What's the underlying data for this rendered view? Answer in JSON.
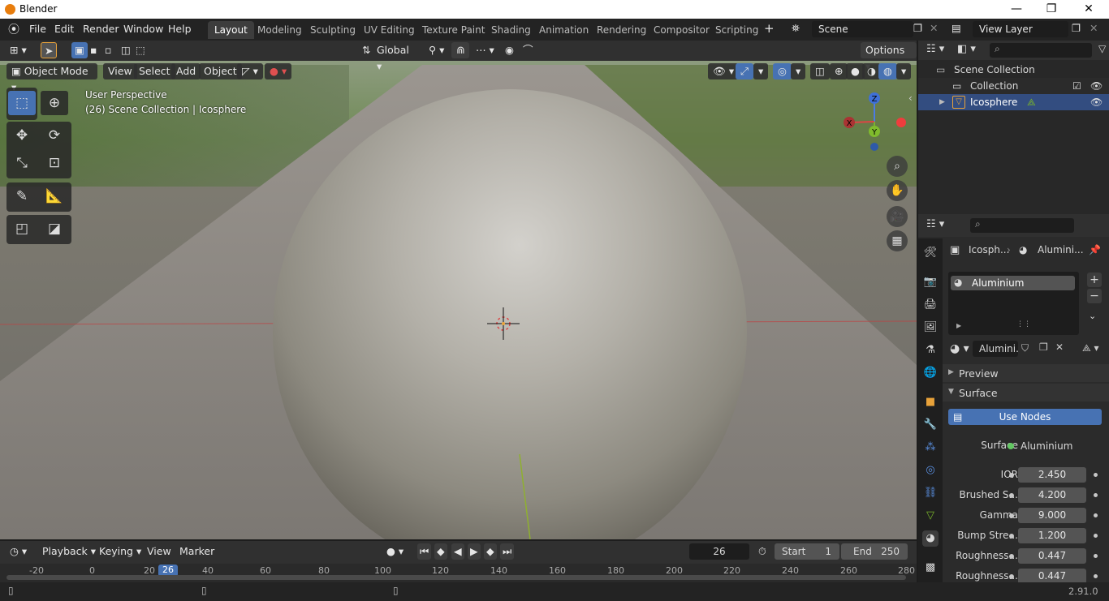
{
  "window": {
    "title": "Blender",
    "controls": {
      "minimize": "—",
      "maximize": "❐",
      "close": "✕"
    }
  },
  "menu": [
    "File",
    "Edit",
    "Render",
    "Window",
    "Help"
  ],
  "workspaces": [
    "Layout",
    "Modeling",
    "Sculpting",
    "UV Editing",
    "Texture Paint",
    "Shading",
    "Animation",
    "Rendering",
    "Compositor",
    "Scripting"
  ],
  "active_workspace": "Layout",
  "scene": {
    "name": "Scene",
    "view_layer": "View Layer"
  },
  "viewport_header": {
    "transform_orientation": "Global",
    "options_label": "Options",
    "mode": "Object Mode",
    "menus": [
      "View",
      "Select",
      "Add",
      "Object"
    ]
  },
  "viewport": {
    "perspective": "User Perspective",
    "info": "(26) Scene Collection | Icosphere",
    "gizmo": {
      "x": "X",
      "y": "Y",
      "z": "Z"
    }
  },
  "outliner": {
    "root": "Scene Collection",
    "collection": "Collection",
    "object": "Icosphere"
  },
  "properties": {
    "breadcrumb_object": "Icosph...",
    "breadcrumb_material": "Alumini...",
    "material_slot": "Aluminium",
    "material_name": "Alumini...",
    "panels": {
      "preview": "Preview",
      "surface": "Surface"
    },
    "use_nodes": "Use Nodes",
    "surface_label": "Surface",
    "surface_value": "Aluminium",
    "fields": [
      {
        "label": "IOR",
        "value": "2.450"
      },
      {
        "label": "Brushed S...",
        "value": "4.200"
      },
      {
        "label": "Gamma",
        "value": "9.000"
      },
      {
        "label": "Bump Stre...",
        "value": "1.200"
      },
      {
        "label": "Roughness...",
        "value": "0.447"
      },
      {
        "label": "Roughness...",
        "value": "0.447"
      }
    ]
  },
  "timeline": {
    "menus": [
      "Playback",
      "Keying",
      "View",
      "Marker"
    ],
    "current_frame": "26",
    "start_label": "Start",
    "start": "1",
    "end_label": "End",
    "end": "250",
    "ruler": [
      "-20",
      "0",
      "20",
      "26",
      "40",
      "60",
      "80",
      "100",
      "120",
      "140",
      "160",
      "180",
      "200",
      "220",
      "240",
      "260",
      "280"
    ]
  },
  "status": {
    "version": "2.91.0"
  },
  "colors": {
    "accent": "#4772b3",
    "selection": "#334d80",
    "active_tool": "#4772b3",
    "object_orange": "#e87d0d"
  }
}
